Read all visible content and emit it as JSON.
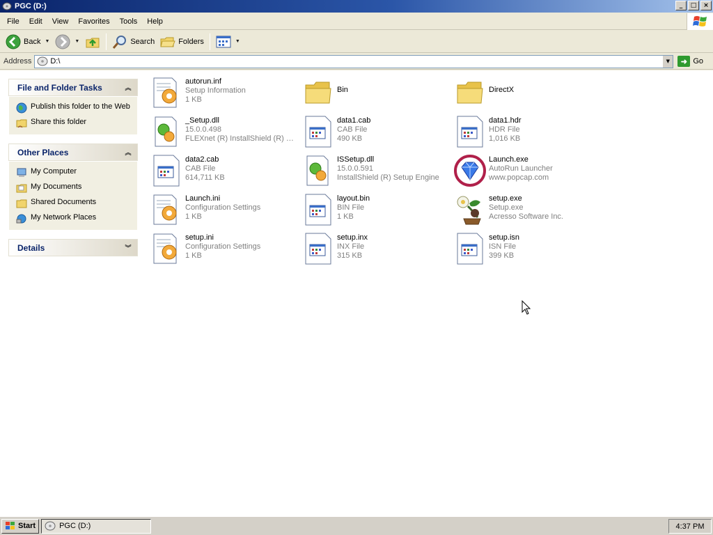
{
  "window": {
    "title": "PGC (D:)",
    "controls": {
      "minimize": "_",
      "maximize": "□",
      "close": "×"
    }
  },
  "menu": [
    "File",
    "Edit",
    "View",
    "Favorites",
    "Tools",
    "Help"
  ],
  "toolbar": {
    "back": "Back",
    "search": "Search",
    "folders": "Folders"
  },
  "address": {
    "label": "Address",
    "value": "D:\\",
    "go": "Go"
  },
  "taskpane": {
    "file_tasks": {
      "title": "File and Folder Tasks",
      "items": [
        "Publish this folder to the Web",
        "Share this folder"
      ]
    },
    "other_places": {
      "title": "Other Places",
      "items": [
        "My Computer",
        "My Documents",
        "Shared Documents",
        "My Network Places"
      ]
    },
    "details": {
      "title": "Details"
    }
  },
  "files": [
    {
      "name": "autorun.inf",
      "line2": "Setup Information",
      "line3": "1 KB",
      "icon": "settings-file"
    },
    {
      "name": "Bin",
      "line2": "",
      "line3": "",
      "icon": "folder"
    },
    {
      "name": "DirectX",
      "line2": "",
      "line3": "",
      "icon": "folder"
    },
    {
      "name": "_Setup.dll",
      "line2": "15.0.0.498",
      "line3": "FLEXnet (R) InstallShield (R) S...",
      "icon": "dll-file"
    },
    {
      "name": "data1.cab",
      "line2": "CAB File",
      "line3": "490 KB",
      "icon": "generic-file"
    },
    {
      "name": "data1.hdr",
      "line2": "HDR File",
      "line3": "1,016 KB",
      "icon": "generic-file"
    },
    {
      "name": "data2.cab",
      "line2": "CAB File",
      "line3": "614,711 KB",
      "icon": "generic-file"
    },
    {
      "name": "ISSetup.dll",
      "line2": "15.0.0.591",
      "line3": "InstallShield (R) Setup Engine",
      "icon": "dll-file"
    },
    {
      "name": "Launch.exe",
      "line2": "AutoRun Launcher",
      "line3": "www.popcap.com",
      "icon": "gem"
    },
    {
      "name": "Launch.ini",
      "line2": "Configuration Settings",
      "line3": "1 KB",
      "icon": "settings-file"
    },
    {
      "name": "layout.bin",
      "line2": "BIN File",
      "line3": "1 KB",
      "icon": "generic-file"
    },
    {
      "name": "setup.exe",
      "line2": "Setup.exe",
      "line3": "Acresso Software Inc.",
      "icon": "plant"
    },
    {
      "name": "setup.ini",
      "line2": "Configuration Settings",
      "line3": "1 KB",
      "icon": "settings-file"
    },
    {
      "name": "setup.inx",
      "line2": "INX File",
      "line3": "315 KB",
      "icon": "generic-file"
    },
    {
      "name": "setup.isn",
      "line2": "ISN File",
      "line3": "399 KB",
      "icon": "generic-file"
    }
  ],
  "taskbar": {
    "start": "Start",
    "window_button": "PGC (D:)",
    "clock": "4:37 PM"
  },
  "colors": {
    "title_gradient_start": "#0A246A",
    "panel_title": "#0A246A",
    "secondary_text": "#7F7F7F"
  }
}
